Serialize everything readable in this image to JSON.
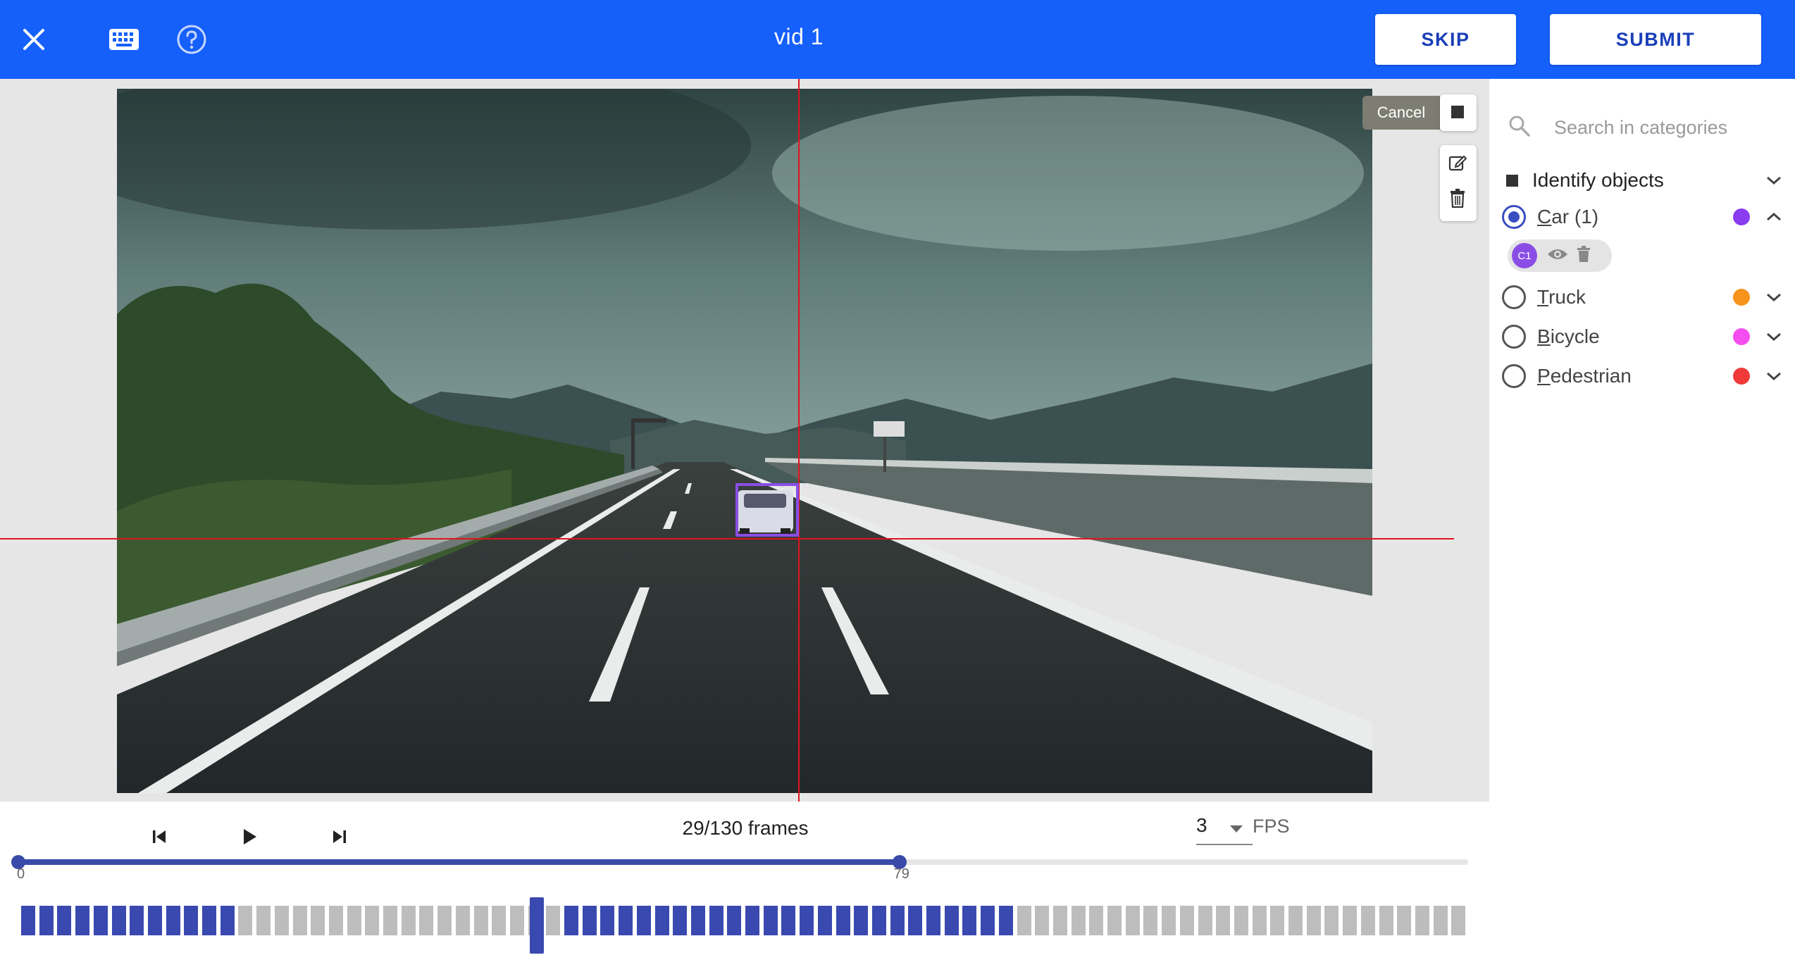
{
  "topbar": {
    "title": "vid 1",
    "skip_label": "SKIP",
    "submit_label": "SUBMIT",
    "bg_color": "#1560fb"
  },
  "canvas": {
    "cancel_label": "Cancel",
    "annotation_color": "#8a4ee6",
    "crosshair_color": "#e0141d"
  },
  "panel": {
    "search_placeholder": "Search in categories",
    "group_label": "Identify objects",
    "categories": [
      {
        "name": "Car (1)",
        "shortcut": "C",
        "rest": "ar (1)",
        "color": "#8a3cf0",
        "selected": true,
        "expanded": true
      },
      {
        "name": "Truck",
        "shortcut": "T",
        "rest": "ruck",
        "color": "#f7941d",
        "selected": false,
        "expanded": false
      },
      {
        "name": "Bicycle",
        "shortcut": "B",
        "rest": "icycle",
        "color": "#f54ef0",
        "selected": false,
        "expanded": false
      },
      {
        "name": "Pedestrian",
        "shortcut": "P",
        "rest": "edestrian",
        "color": "#f03a3a",
        "selected": false,
        "expanded": false
      }
    ],
    "instance": {
      "label": "C1"
    }
  },
  "playback": {
    "frames_text": "29/130 frames",
    "fps_value": "3",
    "fps_label": "FPS",
    "range_start": "0",
    "range_end": "79",
    "total_frames": 130,
    "range_start_frame": 0,
    "range_end_frame": 79,
    "current_frame_index": 28,
    "keyframe_cells": [
      0,
      1,
      2,
      3,
      4,
      5,
      6,
      7,
      8,
      9,
      10,
      11,
      30,
      31,
      32,
      33,
      34,
      35,
      36,
      37,
      38,
      39,
      40,
      41,
      42,
      43,
      44,
      45,
      46,
      47,
      48,
      49,
      50,
      51,
      52,
      53,
      54
    ]
  }
}
